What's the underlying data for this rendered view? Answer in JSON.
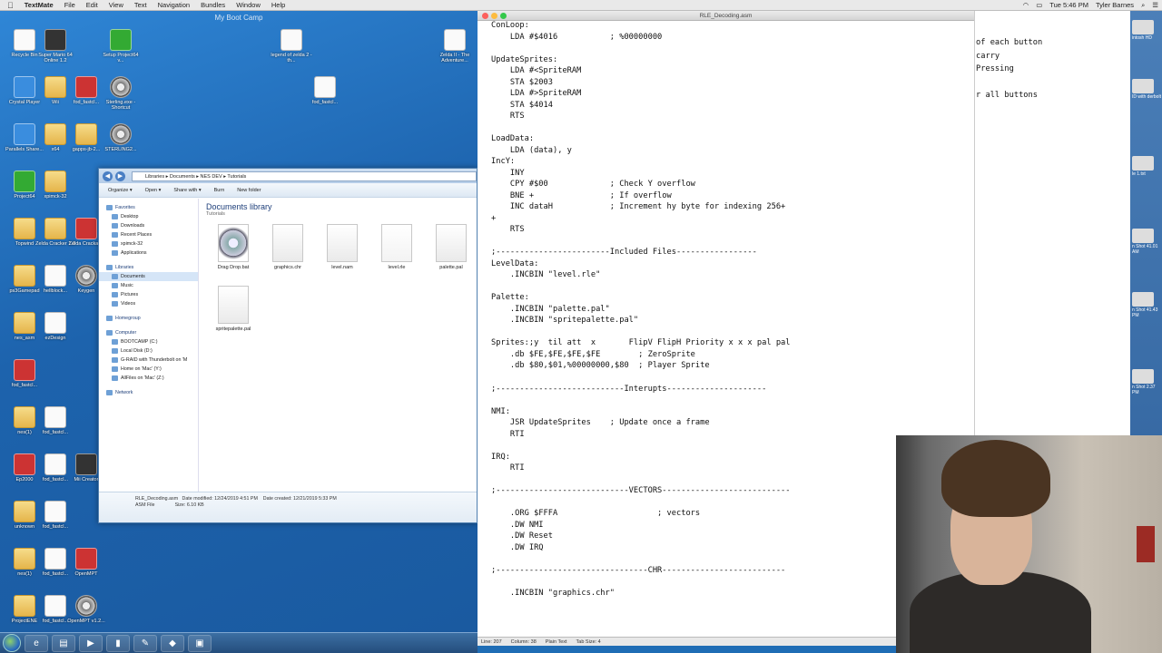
{
  "mac_menu": {
    "apple": "",
    "app": "TextMate",
    "items": [
      "File",
      "Edit",
      "View",
      "Text",
      "Navigation",
      "Bundles",
      "Window",
      "Help"
    ],
    "time": "Tue 5:46 PM",
    "user": "Tyler Barnes"
  },
  "vm": {
    "window_title": "My Boot Camp",
    "desktop_icons": [
      {
        "label": "Recycle Bin",
        "kind": "file"
      },
      {
        "label": "Super Mario 64 Online 1.2",
        "kind": "dark"
      },
      {
        "label": "Setup Project64 v...",
        "kind": "green"
      },
      {
        "label": "legend of zelda 2 - th...",
        "kind": "file"
      },
      {
        "label": "Zelda II - The Adventure...",
        "kind": "file"
      },
      {
        "label": "Crystal Player",
        "kind": "blue"
      },
      {
        "label": "Wii",
        "kind": "folder"
      },
      {
        "label": "fod_fastcl...",
        "kind": "red"
      },
      {
        "label": "Sterling.exe - Shortcut",
        "kind": "gear"
      },
      {
        "label": "fod_fastcl...",
        "kind": "file"
      },
      {
        "label": "Parallels Share...",
        "kind": "blue"
      },
      {
        "label": "x64",
        "kind": "folder"
      },
      {
        "label": "gapps-jb-2...",
        "kind": "folder"
      },
      {
        "label": "STERLING2...",
        "kind": "gear"
      },
      {
        "label": "Project64",
        "kind": "green"
      },
      {
        "label": "xpimck-32",
        "kind": "folder"
      },
      {
        "label": "Topwind",
        "kind": "folder"
      },
      {
        "label": "Zelda Cracker 1.0",
        "kind": "folder"
      },
      {
        "label": "Zelda Crackage",
        "kind": "red"
      },
      {
        "label": "hellblock...",
        "kind": "file"
      },
      {
        "label": "Keygen",
        "kind": "gear"
      },
      {
        "label": "ps3Gamepad",
        "kind": "folder"
      },
      {
        "label": "ezDesign",
        "kind": "file"
      },
      {
        "label": "nes_asm",
        "kind": "folder"
      },
      {
        "label": "fod_fastcl...",
        "kind": "red"
      },
      {
        "label": "nes(1)",
        "kind": "folder"
      },
      {
        "label": "fod_fastcl...",
        "kind": "file"
      },
      {
        "label": "Ep2000",
        "kind": "red"
      },
      {
        "label": "fod_fastcl...",
        "kind": "file"
      },
      {
        "label": "Mii Creator",
        "kind": "dark"
      },
      {
        "label": "unknown",
        "kind": "folder"
      },
      {
        "label": "fod_fastcl...",
        "kind": "file"
      },
      {
        "label": "nes(1)",
        "kind": "folder"
      },
      {
        "label": "fod_fastcl...",
        "kind": "file"
      },
      {
        "label": "OpenMPT",
        "kind": "red"
      },
      {
        "label": "ProjectENE",
        "kind": "folder"
      },
      {
        "label": "fod_fastcl...",
        "kind": "file"
      },
      {
        "label": "OpenMPT v1.2...",
        "kind": "gear"
      }
    ],
    "explorer": {
      "breadcrumb": "Libraries ▸ Documents ▸ NES DEV ▸ Tutorials",
      "toolbar": [
        "Organize ▾",
        "Open ▾",
        "Share with ▾",
        "Burn",
        "New folder"
      ],
      "nav": [
        {
          "label": "Favorites",
          "hdr": true
        },
        {
          "label": "Desktop"
        },
        {
          "label": "Downloads"
        },
        {
          "label": "Recent Places"
        },
        {
          "label": "xpimck-32"
        },
        {
          "label": "Applications"
        },
        {
          "label": "",
          "gap": true
        },
        {
          "label": "Libraries",
          "hdr": true
        },
        {
          "label": "Documents",
          "sel": true
        },
        {
          "label": "Music"
        },
        {
          "label": "Pictures"
        },
        {
          "label": "Videos"
        },
        {
          "label": "",
          "gap": true
        },
        {
          "label": "Homegroup",
          "hdr": true
        },
        {
          "label": "",
          "gap": true
        },
        {
          "label": "Computer",
          "hdr": true
        },
        {
          "label": "BOOTCAMP (C:)"
        },
        {
          "label": "Local Disk (D:)"
        },
        {
          "label": "G-RAID with Thunderbolt on 'M"
        },
        {
          "label": "Home on 'Mac' (Y:)"
        },
        {
          "label": "AllFiles on 'Mac' (Z:)"
        },
        {
          "label": "",
          "gap": true
        },
        {
          "label": "Network",
          "hdr": true
        }
      ],
      "library_title": "Documents library",
      "library_sub": "Tutorials",
      "files": [
        {
          "name": "Drag Drop.bat",
          "kind": "gear"
        },
        {
          "name": "graphics.chr",
          "kind": "doc"
        },
        {
          "name": "level.nam",
          "kind": "doc"
        },
        {
          "name": "level.rle",
          "kind": "bell"
        },
        {
          "name": "palette.pal",
          "kind": "doc"
        },
        {
          "name": "spritepalette.pal",
          "kind": "doc"
        }
      ],
      "details": {
        "name": "RLE_Decoding.asm",
        "type": "ASM File",
        "modified": "Date modified: 12/24/2019 4:51 PM",
        "created": "Date created: 12/21/2019 5:33 PM",
        "size": "Size: 6.10 KB"
      }
    }
  },
  "editor": {
    "file_title": "RLE_Decoding.asm",
    "lines": [
      "ConLoop:",
      "    LDA #$4016           ; %00000000",
      "",
      "UpdateSprites:",
      "    LDA #<SpriteRAM",
      "    STA $2003",
      "    LDA #>SpriteRAM",
      "    STA $4014",
      "    RTS",
      "",
      "LoadData:",
      "    LDA (data), y",
      "IncY:",
      "    INY",
      "    CPY #$00             ; Check Y overflow",
      "    BNE +                ; If overflow",
      "    INC dataH            ; Increment hy byte for indexing 256+",
      "+",
      "    RTS",
      "",
      ";------------------------Included Files-----------------",
      "LevelData:",
      "    .INCBIN \"level.rle\"",
      "",
      "Palette:",
      "    .INCBIN \"palette.pal\"",
      "    .INCBIN \"spritepalette.pal\"",
      "",
      "Sprites:;y  til att  x       FlipV FlipH Priority x x x pal pal",
      "    .db $FE,$FE,$FE,$FE        ; ZeroSprite",
      "    .db $80,$01,%00000000,$80  ; Player Sprite",
      "",
      ";---------------------------Interupts---------------------",
      "",
      "NMI:",
      "    JSR UpdateSprites    ; Update once a frame",
      "    RTI",
      "",
      "IRQ:",
      "    RTI",
      "",
      ";----------------------------VECTORS---------------------------",
      "",
      "    .ORG $FFFA                     ; vectors",
      "    .DW NMI",
      "    .DW Reset",
      "    .DW IRQ",
      "",
      ";--------------------------------CHR--------------------------",
      "",
      "    .INCBIN \"graphics.chr\""
    ],
    "status": [
      "Line:  207",
      "Column: 38",
      "Plain Text",
      "Tab Size:  4"
    ]
  },
  "right_editor": {
    "lines": [
      "of each button",
      "carry",
      "Pressing",
      "",
      "r all buttons"
    ]
  },
  "mac_desktop": {
    "icons": [
      "intosh HD",
      "ID with derbolt",
      "le 1.txt",
      "n Shot 41.01 AM",
      "n Shot 41.43 PM",
      "n Shot 2.37 PM"
    ]
  }
}
